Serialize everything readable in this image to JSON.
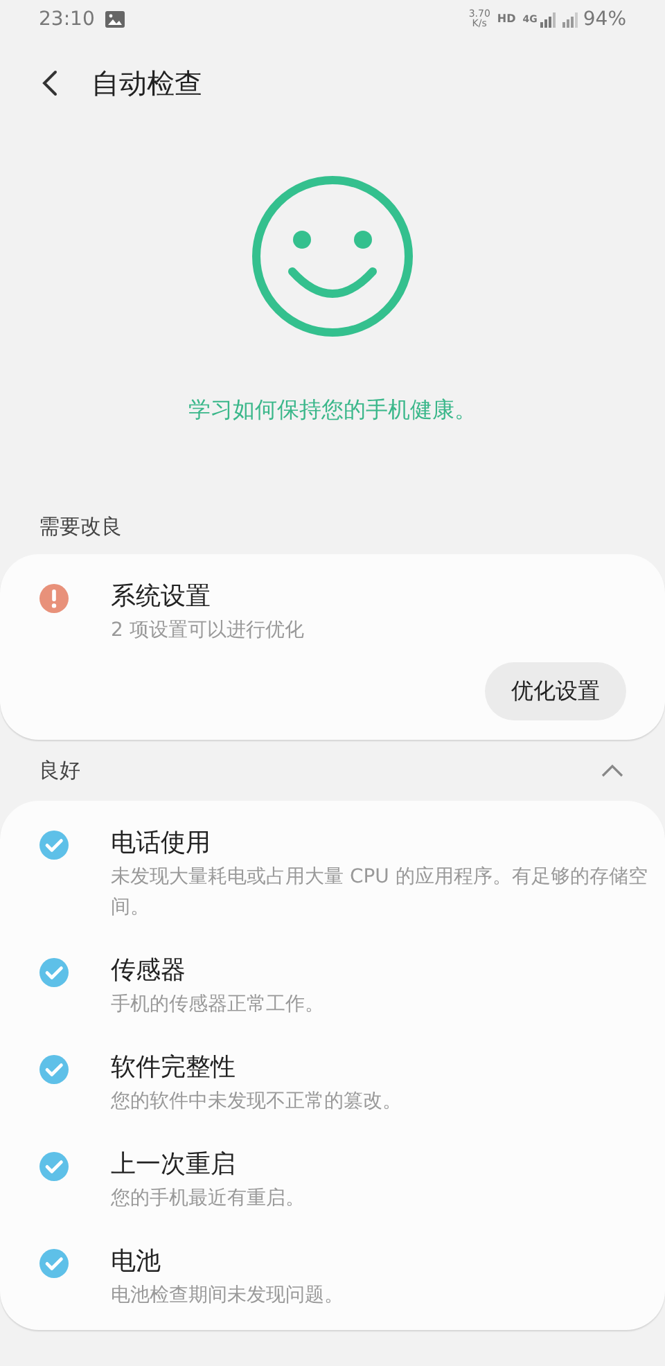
{
  "status_bar": {
    "time": "23:10",
    "speed_value": "3.70",
    "speed_unit": "K/s",
    "hd": "HD",
    "network": "4G",
    "battery": "94%"
  },
  "header": {
    "title": "自动检查"
  },
  "hero": {
    "message": "学习如何保持您的手机健康。"
  },
  "sections": [
    {
      "title": "需要改良",
      "kind": "warning",
      "items": [
        {
          "title": "系统设置",
          "description": "2 项设置可以进行优化"
        }
      ],
      "action": "优化设置"
    },
    {
      "title": "良好",
      "kind": "ok",
      "expanded": true,
      "items": [
        {
          "title": "电话使用",
          "description": "未发现大量耗电或占用大量 CPU 的应用程序。有足够的存储空间。"
        },
        {
          "title": "传感器",
          "description": "手机的传感器正常工作。"
        },
        {
          "title": "软件完整性",
          "description": "您的软件中未发现不正常的篡改。"
        },
        {
          "title": "上一次重启",
          "description": "您的手机最近有重启。"
        },
        {
          "title": "电池",
          "description": "电池检查期间未发现问题。"
        }
      ]
    }
  ]
}
